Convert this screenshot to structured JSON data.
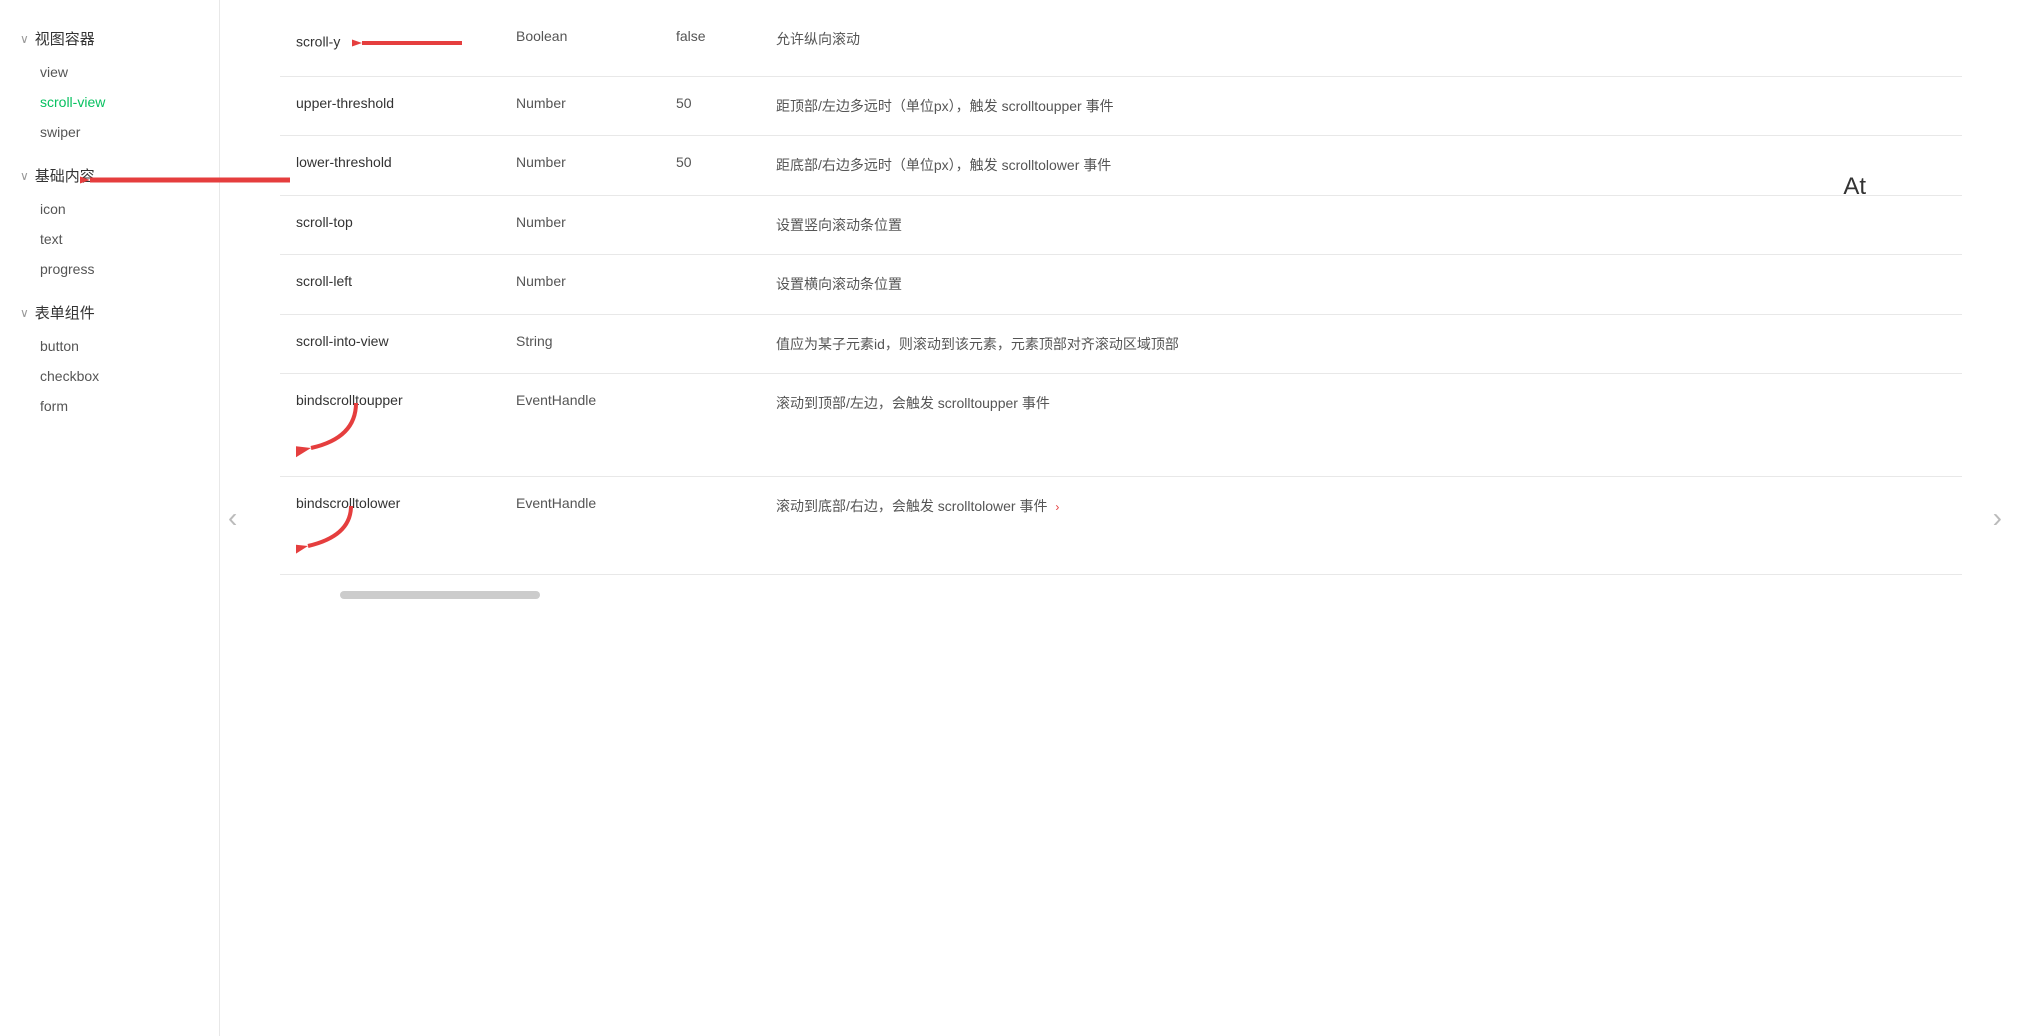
{
  "sidebar": {
    "sections": [
      {
        "id": "view-container",
        "label": "视图容器",
        "expanded": true,
        "items": [
          {
            "id": "view",
            "label": "view",
            "active": false
          },
          {
            "id": "scroll-view",
            "label": "scroll-view",
            "active": true
          },
          {
            "id": "swiper",
            "label": "swiper",
            "active": false
          }
        ]
      },
      {
        "id": "basic-content",
        "label": "基础内容",
        "expanded": true,
        "items": [
          {
            "id": "icon",
            "label": "icon",
            "active": false
          },
          {
            "id": "text",
            "label": "text",
            "active": false
          },
          {
            "id": "progress",
            "label": "progress",
            "active": false
          }
        ]
      },
      {
        "id": "form-components",
        "label": "表单组件",
        "expanded": true,
        "items": [
          {
            "id": "button",
            "label": "button",
            "active": false
          },
          {
            "id": "checkbox",
            "label": "checkbox",
            "active": false
          },
          {
            "id": "form",
            "label": "form",
            "active": false
          }
        ]
      }
    ]
  },
  "table": {
    "rows": [
      {
        "attr": "scroll-y",
        "type": "Boolean",
        "default": "false",
        "description": "允许纵向滚动",
        "has_arrow": true,
        "arrow_from_right": true
      },
      {
        "attr": "upper-threshold",
        "type": "Number",
        "default": "50",
        "description": "距顶部/左边多远时（单位px），触发 scrolltoupper 事件",
        "has_arrow": false
      },
      {
        "attr": "lower-threshold",
        "type": "Number",
        "default": "50",
        "description": "距底部/右边多远时（单位px），触发 scrolltolower 事件",
        "has_arrow": false
      },
      {
        "attr": "scroll-top",
        "type": "Number",
        "default": "",
        "description": "设置竖向滚动条位置",
        "has_arrow": false
      },
      {
        "attr": "scroll-left",
        "type": "Number",
        "default": "",
        "description": "设置横向滚动条位置",
        "has_arrow": false
      },
      {
        "attr": "scroll-into-view",
        "type": "String",
        "default": "",
        "description": "值应为某子元素id，则滚动到该元素，元素顶部对齐滚动区域顶部",
        "has_arrow": false
      },
      {
        "attr": "bindscrolltoupper",
        "type": "EventHandle",
        "default": "",
        "description": "滚动到顶部/左边，会触发 scrolltoupper 事件",
        "has_arrow": true,
        "arrow_direction": "down"
      },
      {
        "attr": "bindscrolltolower",
        "type": "EventHandle",
        "default": "",
        "description": "滚动到底部/右边，会触发 scrolltolower 事件",
        "has_arrow": true,
        "arrow_direction": "down",
        "has_gt": true
      }
    ]
  },
  "nav": {
    "left_arrow": "‹",
    "right_arrow": "›"
  },
  "at_label": "At"
}
